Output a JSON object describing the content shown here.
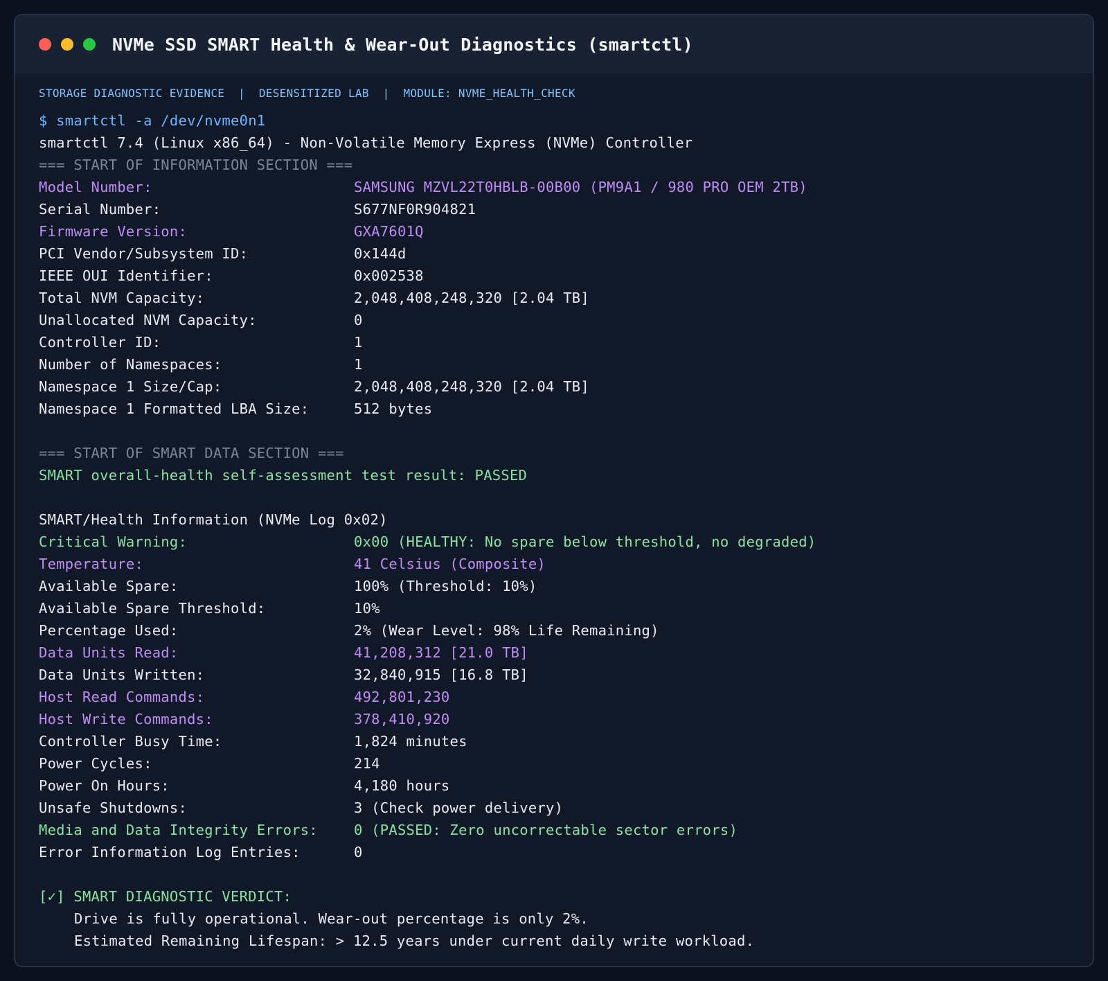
{
  "window": {
    "title": "NVMe SSD SMART Health & Wear-Out Diagnostics (smartctl)"
  },
  "meta": {
    "text": "STORAGE DIAGNOSTIC EVIDENCE  |  DESENSITIZED LAB  |  MODULE: NVME_HEALTH_CHECK"
  },
  "terminal": {
    "command": "$ smartctl -a /dev/nvme0n1",
    "version_line": "smartctl 7.4 (Linux x86_64) - Non-Volatile Memory Express (NVMe) Controller",
    "info_header": "=== START OF INFORMATION SECTION ===",
    "info": [
      {
        "key": "Model Number:",
        "value": "SAMSUNG MZVL22T0HBLB-00B00 (PM9A1 / 980 PRO OEM 2TB)"
      },
      {
        "key": "Serial Number:",
        "value": "S677NF0R904821"
      },
      {
        "key": "Firmware Version:",
        "value": "GXA7601Q"
      },
      {
        "key": "PCI Vendor/Subsystem ID:",
        "value": "0x144d"
      },
      {
        "key": "IEEE OUI Identifier:",
        "value": "0x002538"
      },
      {
        "key": "Total NVM Capacity:",
        "value": "2,048,408,248,320 [2.04 TB]"
      },
      {
        "key": "Unallocated NVM Capacity:",
        "value": "0"
      },
      {
        "key": "Controller ID:",
        "value": "1"
      },
      {
        "key": "Number of Namespaces:",
        "value": "1"
      },
      {
        "key": "Namespace 1 Size/Cap:",
        "value": "2,048,408,248,320 [2.04 TB]"
      },
      {
        "key": "Namespace 1 Formatted LBA Size:",
        "value": "512 bytes"
      }
    ],
    "smart_header": "=== START OF SMART DATA SECTION ===",
    "smart_result": "SMART overall-health self-assessment test result: PASSED",
    "health_header": "SMART/Health Information (NVMe Log 0x02)",
    "health": [
      {
        "key": "Critical Warning:",
        "value": "0x00 (HEALTHY: No spare below threshold, no degraded)"
      },
      {
        "key": "Temperature:",
        "value": "41 Celsius (Composite)"
      },
      {
        "key": "Available Spare:",
        "value": "100% (Threshold: 10%)"
      },
      {
        "key": "Available Spare Threshold:",
        "value": "10%"
      },
      {
        "key": "Percentage Used:",
        "value": "2% (Wear Level: 98% Life Remaining)"
      },
      {
        "key": "Data Units Read:",
        "value": "41,208,312 [21.0 TB]"
      },
      {
        "key": "Data Units Written:",
        "value": "32,840,915 [16.8 TB]"
      },
      {
        "key": "Host Read Commands:",
        "value": "492,801,230"
      },
      {
        "key": "Host Write Commands:",
        "value": "378,410,920"
      },
      {
        "key": "Controller Busy Time:",
        "value": "1,824 minutes"
      },
      {
        "key": "Power Cycles:",
        "value": "214"
      },
      {
        "key": "Power On Hours:",
        "value": "4,180 hours"
      },
      {
        "key": "Unsafe Shutdowns:",
        "value": "3 (Check power delivery)"
      },
      {
        "key": "Media and Data Integrity Errors:",
        "value": "0 (PASSED: Zero uncorrectable sector errors)"
      },
      {
        "key": "Error Information Log Entries:",
        "value": "0"
      }
    ],
    "verdict": {
      "header": "[✓] SMART DIAGNOSTIC VERDICT:",
      "line1": "Drive is fully operational. Wear-out percentage is only 2%.",
      "line2": "Estimated Remaining Lifespan: > 12.5 years under current daily write workload."
    }
  },
  "colors": {
    "background": "#111828",
    "titlebar": "#192232",
    "command": "#6cb6ff",
    "highlight_purple": "#c08cf5",
    "ok_green": "#86e3a0",
    "section_gray": "#7b8596",
    "text": "#e8ebf1"
  }
}
